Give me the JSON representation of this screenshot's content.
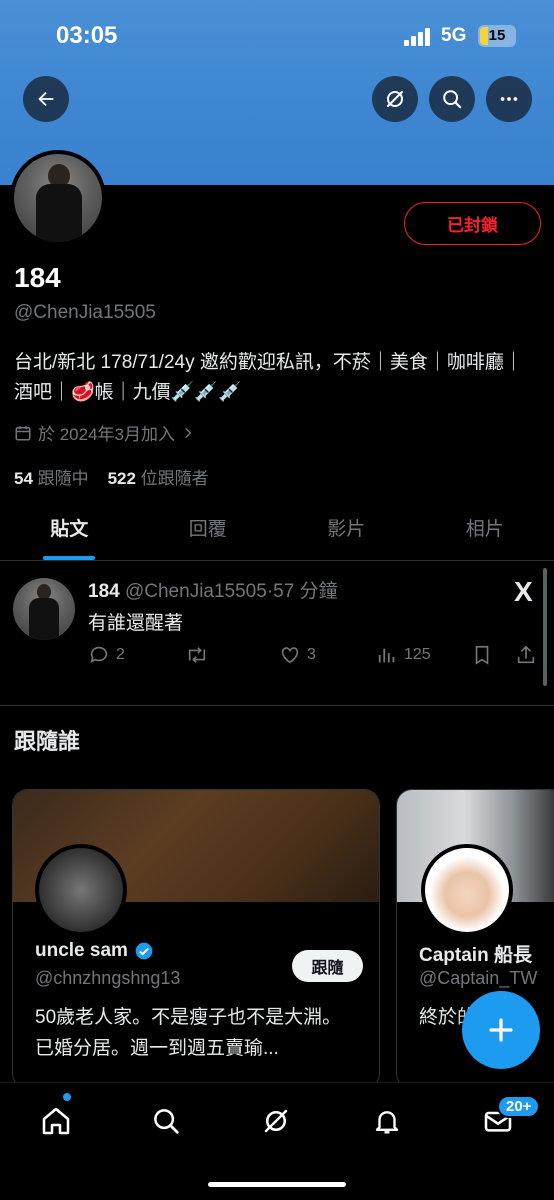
{
  "status_bar": {
    "time": "03:05",
    "network": "5G",
    "battery": "15"
  },
  "header_icons": {
    "back": "back-arrow-icon",
    "grok": "grok-icon",
    "search": "search-icon",
    "more": "more-icon"
  },
  "profile": {
    "blocked_label": "已封鎖",
    "display_name": "184",
    "handle": "@ChenJia15505",
    "bio": "台北/新北 178/71/24y 邀約歡迎私訊，不菸｜美食｜咖啡廳｜酒吧｜🥩帳｜九價💉💉💉",
    "joined": "於 2024年3月加入",
    "following_count": "54",
    "following_label": "跟隨中",
    "followers_count": "522",
    "followers_label": "位跟隨者"
  },
  "tabs": [
    "貼文",
    "回覆",
    "影片",
    "相片"
  ],
  "tweet": {
    "name": "184",
    "handle": "@ChenJia15505",
    "time": "·57 分鐘",
    "text": "有誰還醒著",
    "replies": "2",
    "likes": "3",
    "views": "125",
    "platform_logo": "X"
  },
  "who_to_follow": {
    "title": "跟隨誰",
    "cards": [
      {
        "name": "uncle sam",
        "handle": "@chnzhngshng13",
        "bio": "50歲老人家。不是瘦子也不是大淵。已婚分居。週一到週五賣瑜...",
        "follow_label": "跟隨"
      },
      {
        "name": "Captain 船長",
        "handle": "@Captain_TW",
        "bio": "終於的..."
      }
    ]
  },
  "fab": {
    "icon": "compose-plus-icon"
  },
  "nav": {
    "messages_badge": "20+"
  },
  "colors": {
    "accent": "#1d9bf0",
    "danger": "#f4212e",
    "banner": "#4a90d6"
  }
}
